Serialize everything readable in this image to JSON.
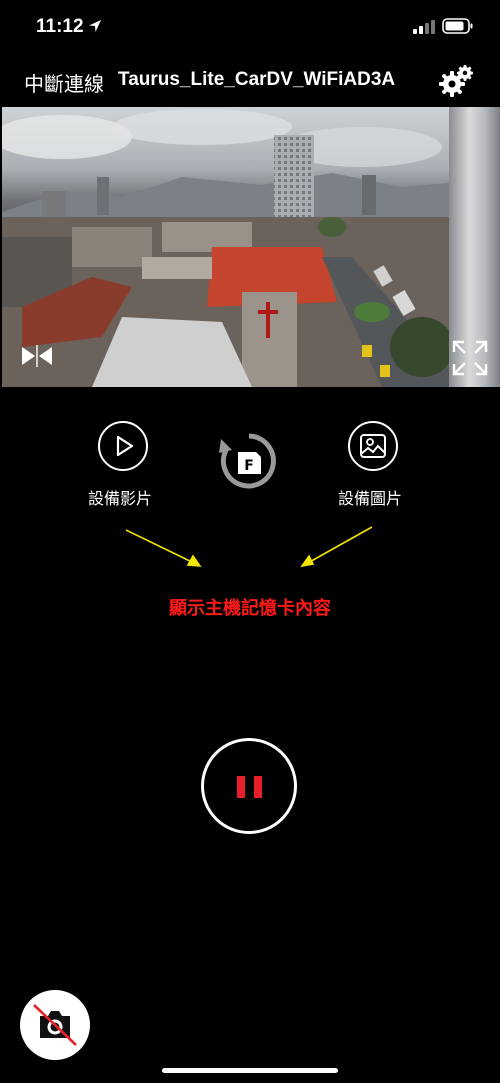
{
  "status_bar": {
    "time": "11:12"
  },
  "topbar": {
    "disconnect_label": "中斷連線",
    "device_name": "Taurus_Lite_CarDV_WiFiAD3A"
  },
  "controls": {
    "device_videos_label": "設備影片",
    "device_photos_label": "設備圖片",
    "format_badge": "F"
  },
  "annotation": {
    "memory_card_note": "顯示主機記憶卡內容",
    "arrow_color": "#f2e600",
    "note_color": "#ff1a1a"
  },
  "icons": {
    "location": "location-arrow-icon",
    "signal": "cellular-signal-icon",
    "battery": "battery-icon",
    "settings": "gear-icon",
    "mirror": "mirror-flip-icon",
    "fullscreen": "expand-icon",
    "play": "play-icon",
    "image": "image-icon",
    "format": "rotate-format-icon",
    "pause": "pause-icon",
    "camera_disabled": "camera-off-icon"
  },
  "colors": {
    "record_accent": "#e8202a",
    "background": "#000000"
  }
}
